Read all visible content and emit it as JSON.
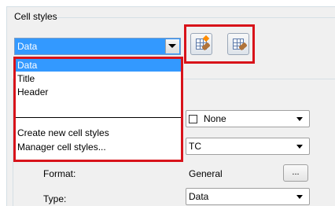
{
  "group": {
    "title": "Cell styles"
  },
  "combo": {
    "selected": "Data"
  },
  "toolbar": {
    "create_icon": "new-cell-style-icon",
    "manage_icon": "manage-cell-styles-icon"
  },
  "dropdown_list": {
    "items": [
      "Data",
      "Title",
      "Header",
      "Create new cell styles",
      "Manager cell styles..."
    ],
    "selected_index": 0
  },
  "properties": {
    "fill_value": "None",
    "alignment_value": "TC",
    "format_label": "Format:",
    "format_value": "General",
    "format_button": "...",
    "type_label": "Type:",
    "type_value": "Data"
  },
  "colors": {
    "selection": "#3399ff",
    "highlight": "#d8131a",
    "panel": "#f0f0f0"
  }
}
